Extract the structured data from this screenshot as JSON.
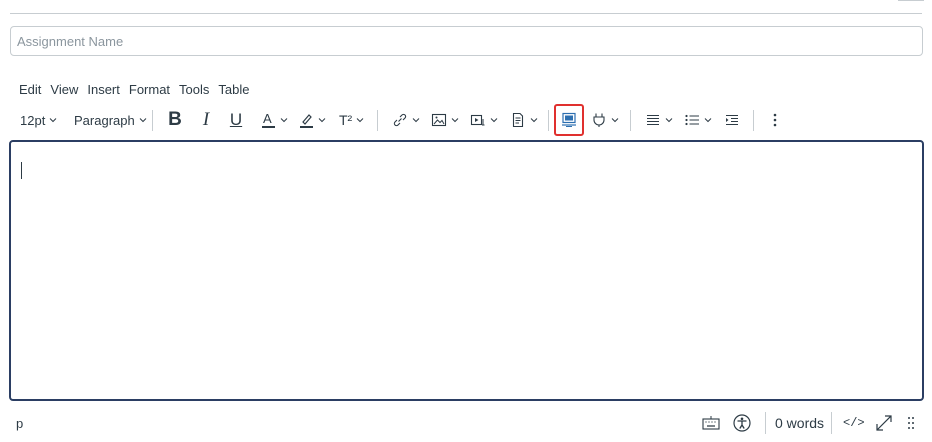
{
  "assignment": {
    "name_placeholder": "Assignment Name",
    "name_value": ""
  },
  "menubar": {
    "items": [
      "Edit",
      "View",
      "Insert",
      "Format",
      "Tools",
      "Table"
    ]
  },
  "toolbar": {
    "font_size": "12pt",
    "block_format": "Paragraph",
    "buttons": [
      {
        "name": "bold-icon",
        "label": "B"
      },
      {
        "name": "italic-icon",
        "label": "I"
      },
      {
        "name": "underline-icon",
        "label": "U"
      },
      {
        "name": "text-color-icon",
        "label": "A"
      },
      {
        "name": "highlight-icon"
      },
      {
        "name": "superscript-icon",
        "label": "T²"
      },
      {
        "name": "link-icon"
      },
      {
        "name": "image-icon"
      },
      {
        "name": "media-icon"
      },
      {
        "name": "document-icon"
      },
      {
        "name": "embed-icon"
      },
      {
        "name": "plugin-icon"
      },
      {
        "name": "align-icon"
      },
      {
        "name": "list-icon"
      },
      {
        "name": "indent-icon"
      },
      {
        "name": "more-icon"
      }
    ],
    "highlight_color": "#e0302e"
  },
  "editor": {
    "content": ""
  },
  "statusbar": {
    "path": "p",
    "word_count": "0 words",
    "code_toggle": "</>"
  },
  "colors": {
    "accent_border": "#2b3e63",
    "text": "#2d3b45",
    "divider": "#c7cdd1"
  }
}
